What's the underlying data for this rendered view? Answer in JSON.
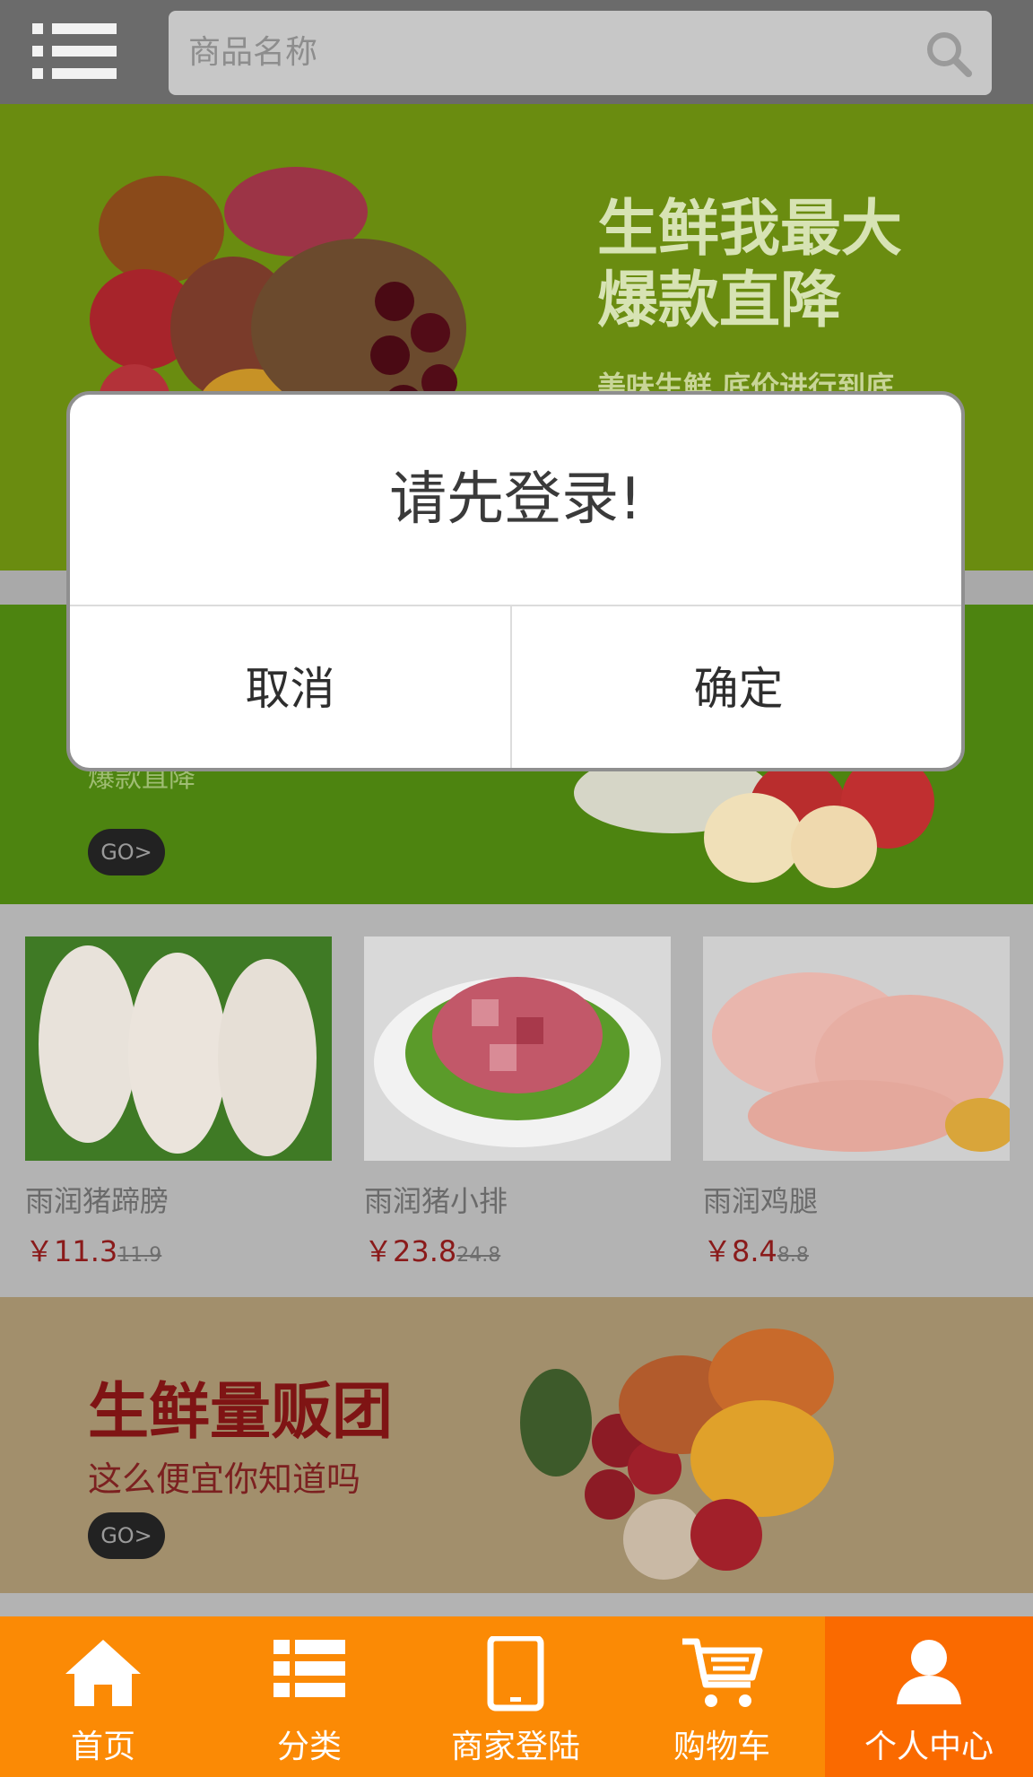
{
  "header": {
    "search_placeholder": "商品名称"
  },
  "banner_top": {
    "headline_line1": "生鲜我最大",
    "headline_line2": "爆款直降",
    "subline": "美味生鲜 底价进行到底"
  },
  "banner_mid": {
    "subtitle": "爆款直降",
    "go_label": "GO>"
  },
  "products": [
    {
      "name": "雨润猪蹄膀",
      "price": "￥11.3",
      "old_price": "11.9"
    },
    {
      "name": "雨润猪小排",
      "price": "￥23.8",
      "old_price": "24.8"
    },
    {
      "name": "雨润鸡腿",
      "price": "￥8.4",
      "old_price": "8.8"
    }
  ],
  "banner_bottom": {
    "title": "生鲜量贩团",
    "subtitle": "这么便宜你知道吗",
    "go_label": "GO>"
  },
  "dialog": {
    "message": "请先登录!",
    "cancel_label": "取消",
    "confirm_label": "确定"
  },
  "bottom_nav": {
    "items": [
      {
        "label": "首页",
        "icon": "home-icon"
      },
      {
        "label": "分类",
        "icon": "list-icon"
      },
      {
        "label": "商家登陆",
        "icon": "tablet-icon"
      },
      {
        "label": "购物车",
        "icon": "cart-icon"
      },
      {
        "label": "个人中心",
        "icon": "user-icon"
      }
    ],
    "active_index": 4
  },
  "colors": {
    "header_bg": "#6b6b6b",
    "nav_bg": "#fb8a05",
    "nav_active": "#fa6a00",
    "price_red": "#8a1a1a"
  }
}
